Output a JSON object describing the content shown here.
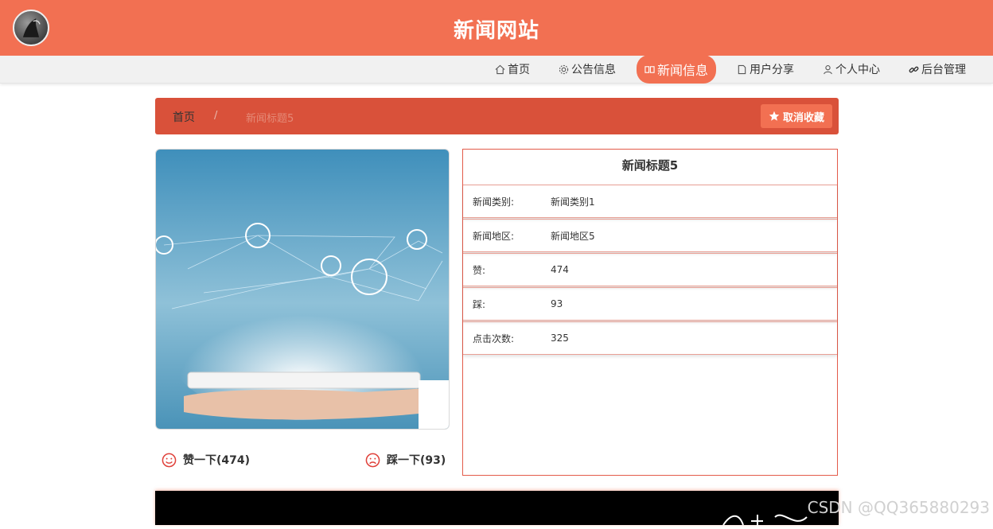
{
  "header": {
    "site_title": "新闻网站",
    "logo_icon": "logo-icon"
  },
  "nav": {
    "items": [
      {
        "label": "首页",
        "icon": "home-icon",
        "active": false
      },
      {
        "label": "公告信息",
        "icon": "gear-icon",
        "active": false
      },
      {
        "label": "新闻信息",
        "icon": "news-icon",
        "active": true
      },
      {
        "label": "用户分享",
        "icon": "doc-icon",
        "active": false
      },
      {
        "label": "个人中心",
        "icon": "user-icon",
        "active": false
      },
      {
        "label": "后台管理",
        "icon": "link-icon",
        "active": false
      }
    ]
  },
  "breadcrumb": {
    "home": "首页",
    "separator": "/",
    "current": "新闻标题5"
  },
  "actions": {
    "unfavorite_label": "取消收藏"
  },
  "votes": {
    "like_label": "赞一下(474)",
    "dislike_label": "踩一下(93)"
  },
  "detail": {
    "title": "新闻标题5",
    "rows": [
      {
        "label": "新闻类别:",
        "value": "新闻类别1"
      },
      {
        "label": "新闻地区:",
        "value": "新闻地区5"
      },
      {
        "label": "赞:",
        "value": "474"
      },
      {
        "label": "踩:",
        "value": "93"
      },
      {
        "label": "点击次数:",
        "value": "325"
      }
    ]
  },
  "watermark": "CSDN @QQ365880293",
  "colors": {
    "brand": "#f27052",
    "breadcrumb_bg": "#d9513a",
    "panel_border": "#e35b4a"
  }
}
